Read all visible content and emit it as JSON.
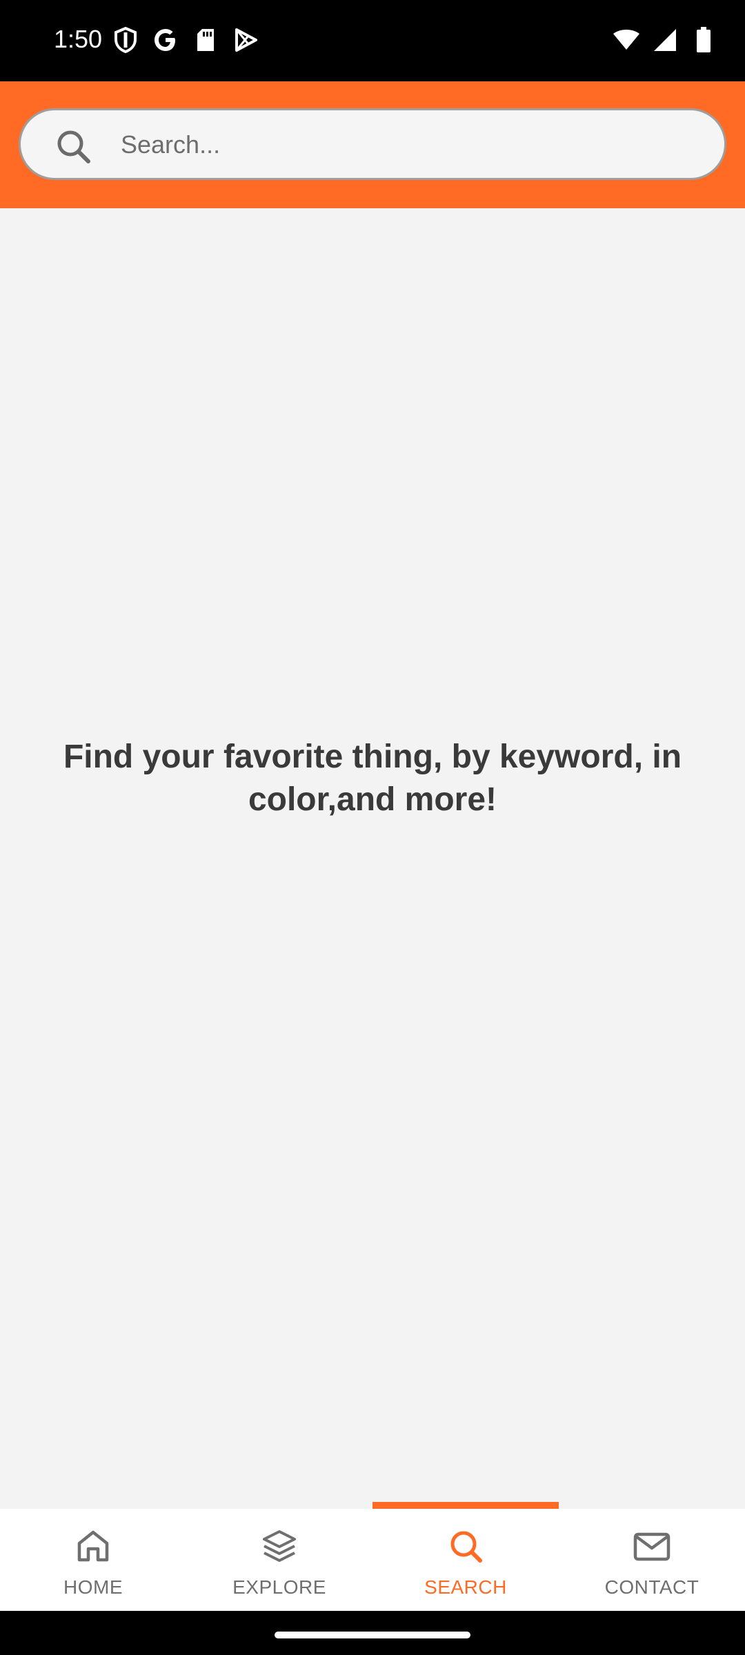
{
  "status_bar": {
    "time": "1:50",
    "left_icons": [
      "shield-icon",
      "google-icon",
      "sd-card-icon",
      "play-store-icon"
    ],
    "right_icons": [
      "wifi-icon",
      "cellular-signal-icon",
      "battery-icon"
    ]
  },
  "header": {
    "color": "#ff6b24",
    "search": {
      "placeholder": "Search...",
      "value": "",
      "icon": "search-icon"
    }
  },
  "main": {
    "empty_message": "Find your favorite thing, by keyword, in color,and more!"
  },
  "bottom_nav": {
    "active_color": "#ff6b24",
    "inactive_color": "#6f6f6f",
    "items": [
      {
        "label": "HOME",
        "icon": "home-icon",
        "active": false
      },
      {
        "label": "EXPLORE",
        "icon": "layers-icon",
        "active": false
      },
      {
        "label": "SEARCH",
        "icon": "search-icon",
        "active": true
      },
      {
        "label": "CONTACT",
        "icon": "mail-icon",
        "active": false
      }
    ]
  }
}
